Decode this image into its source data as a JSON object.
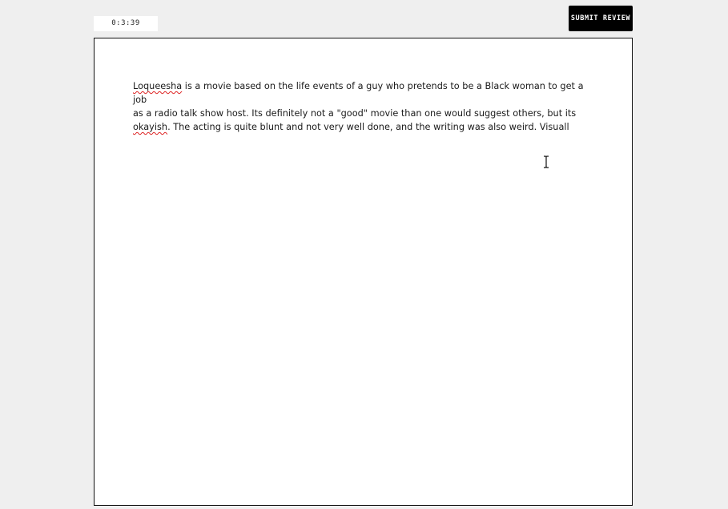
{
  "header": {
    "timer": "0:3:39",
    "submit_label": "SUBMIT REVIEW"
  },
  "editor": {
    "lines": [
      {
        "segments": [
          {
            "text": "Loqueesha",
            "misspelled": true
          },
          {
            "text": " is a movie based on the life events of a guy who pretends to be a Black woman to get a job",
            "misspelled": false
          }
        ]
      },
      {
        "segments": [
          {
            "text": "as a radio talk show host. Its definitely not a \"good\" movie than one would suggest others, but its",
            "misspelled": false
          }
        ]
      },
      {
        "segments": [
          {
            "text": "okayish",
            "misspelled": true
          },
          {
            "text": ". The acting is quite blunt and not very well done, and the writing was also weird. Visuall",
            "misspelled": false
          }
        ]
      }
    ]
  },
  "colors": {
    "background": "#efefef",
    "button_bg": "#000000",
    "button_text": "#ffffff",
    "spellcheck_underline": "#dd2222"
  },
  "icons": {
    "cursor": "text-cursor-icon"
  }
}
